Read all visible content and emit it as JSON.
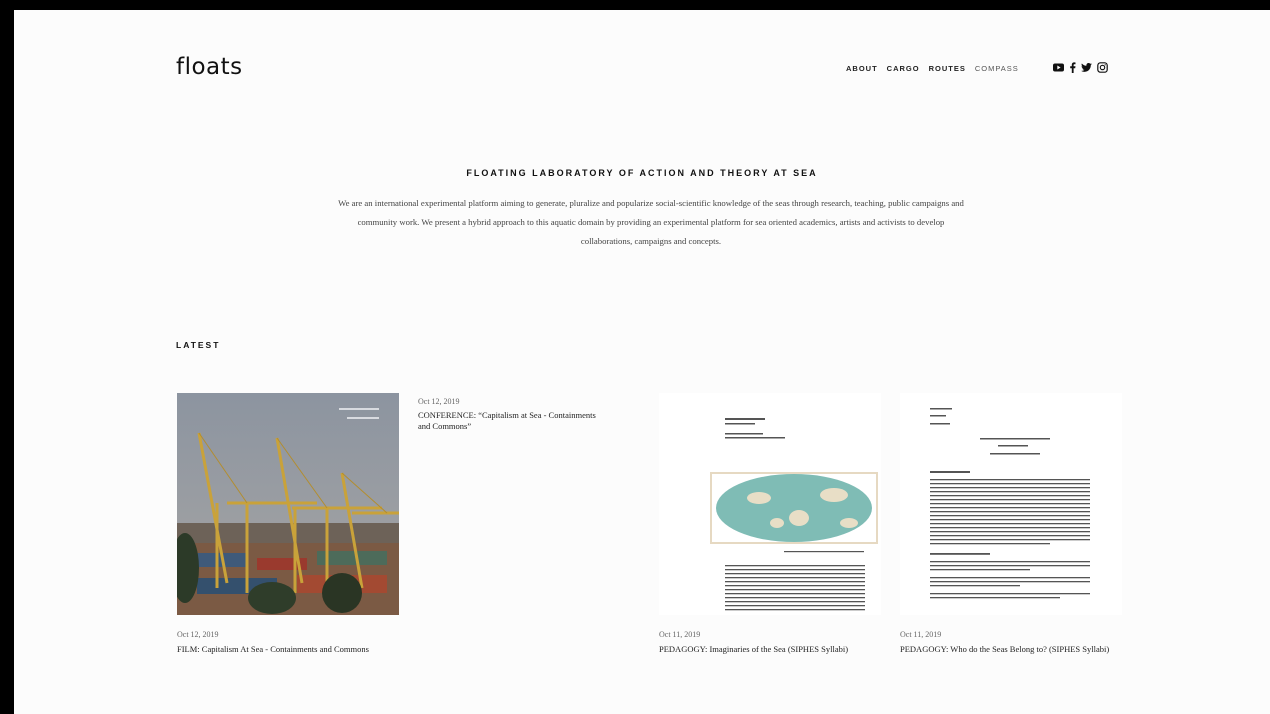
{
  "site": {
    "logo": "floats"
  },
  "nav": [
    {
      "label": "ABOUT"
    },
    {
      "label": "CARGO"
    },
    {
      "label": "ROUTES"
    },
    {
      "label": "COMPASS"
    }
  ],
  "social_icons": [
    "youtube-icon",
    "facebook-icon",
    "twitter-icon",
    "instagram-icon"
  ],
  "mission": {
    "title": "FLOATING LABORATORY OF ACTION AND THEORY AT SEA",
    "text": "We are an international experimental platform aiming to generate, pluralize and popularize social-scientific knowledge of the seas through research, teaching, public campaigns and community work. We present a hybrid approach to this aquatic domain by providing an experimental platform for sea oriented academics, artists and activists to develop collaborations, campaigns and concepts."
  },
  "latest": {
    "heading": "LATEST",
    "posts": [
      {
        "date": "Oct 12, 2019",
        "title": "FILM: Capitalism At Sea - Containments and Commons"
      },
      {
        "date": "Oct 12, 2019",
        "title": "CONFERENCE: “Capitalism at Sea - Containments and Commons”"
      },
      {
        "date": "Oct 11, 2019",
        "title": "PEDAGOGY: Imaginaries of the Sea (SIPHES Syllabi)"
      },
      {
        "date": "Oct 11, 2019",
        "title": "PEDAGOGY: Who do the Seas Belong to? (SIPHES Syllabi)"
      }
    ]
  },
  "colors": {
    "page_bg": "#fcfcfc",
    "frame": "#000000",
    "text": "#222222",
    "crane": "#c9a23a"
  }
}
